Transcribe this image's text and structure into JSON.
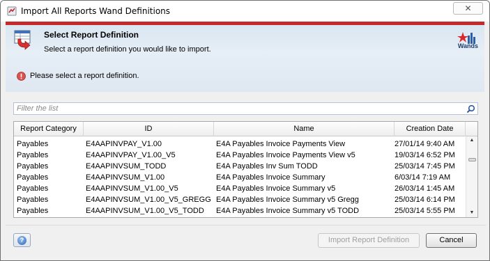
{
  "window": {
    "title": "Import All Reports Wand Definitions",
    "close_glyph": "✕"
  },
  "header": {
    "title": "Select Report Definition",
    "description": "Select a report definition you would like to import.",
    "logo_text": "Wands",
    "error_message": "Please select a report definition.",
    "accent_color": "#c42a2a"
  },
  "filter": {
    "placeholder": "Filter the list",
    "value": ""
  },
  "table": {
    "columns": [
      "Report Category",
      "ID",
      "Name",
      "Creation Date"
    ],
    "rows": [
      [
        "Payables",
        "E4AAPINVPAY_V1.00",
        "E4A Payables Invoice Payments View",
        "27/01/14 9:40 AM"
      ],
      [
        "Payables",
        "E4AAPINVPAY_V1.00_V5",
        "E4A Payables Invoice Payments View v5",
        "19/03/14 6:52 PM"
      ],
      [
        "Payables",
        "E4AAPINVSUM_TODD",
        "E4A Payables Inv Sum TODD",
        "25/03/14 7:45 PM"
      ],
      [
        "Payables",
        "E4AAPINVSUM_V1.00",
        "E4A Payables Invoice Summary",
        "6/03/14 7:19 AM"
      ],
      [
        "Payables",
        "E4AAPINVSUM_V1.00_V5",
        "E4A Payables Invoice Summary v5",
        "26/03/14 1:45 AM"
      ],
      [
        "Payables",
        "E4AAPINVSUM_V1.00_V5_GREGG",
        "E4A Payables Invoice Summary v5 Gregg",
        "25/03/14 6:14 PM"
      ],
      [
        "Payables",
        "E4AAPINVSUM_V1.00_V5_TODD",
        "E4A Payables Invoice Summary v5 TODD",
        "25/03/14 5:55 PM"
      ]
    ]
  },
  "buttons": {
    "import": "Import Report Definition",
    "cancel": "Cancel",
    "help_glyph": "?"
  }
}
